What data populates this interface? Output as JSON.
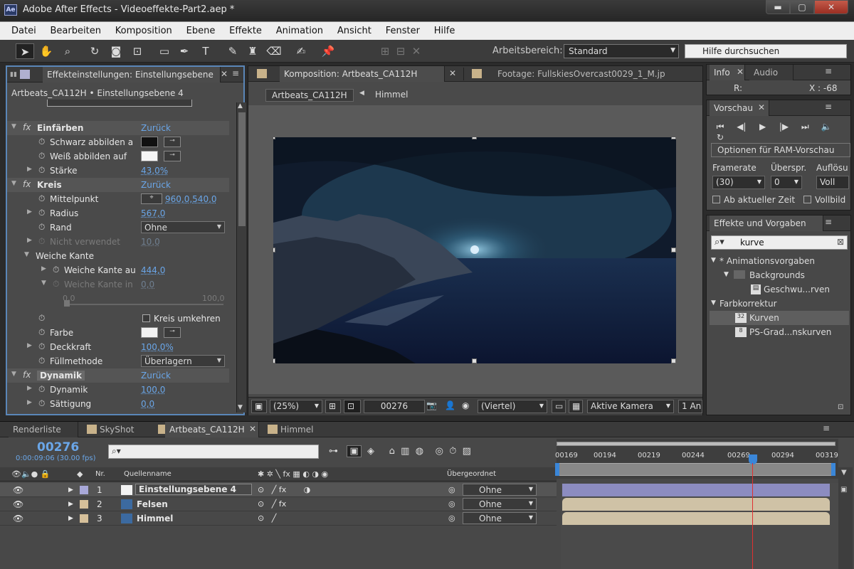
{
  "window": {
    "title": "Adobe After Effects - Videoeffekte-Part2.aep *",
    "logo": "Ae",
    "minimize": "▬",
    "maximize": "▢",
    "close": "✕"
  },
  "menu": [
    "Datei",
    "Bearbeiten",
    "Komposition",
    "Ebene",
    "Effekte",
    "Animation",
    "Ansicht",
    "Fenster",
    "Hilfe"
  ],
  "toolbar": {
    "workspace_label": "Arbeitsbereich:",
    "workspace_value": "Standard",
    "help_placeholder": "Hilfe durchsuchen"
  },
  "effect_panel": {
    "tab": "Effekteinstellungen: Einstellungsebene",
    "subtitle": "Artbeats_CA112H • Einstellungsebene 4",
    "rows": [
      {
        "type": "fx",
        "label": "Einfärben",
        "reset": "Zurück"
      },
      {
        "label": "Schwarz abbilden a",
        "swatch": "#111111"
      },
      {
        "label": "Weiß abbilden auf",
        "swatch": "#f5f5f5"
      },
      {
        "label": "Stärke",
        "value": "43,0%"
      },
      {
        "type": "fx",
        "label": "Kreis",
        "reset": "Zurück"
      },
      {
        "label": "Mittelpunkt",
        "value": "960,0,540,0"
      },
      {
        "label": "Radius",
        "value": "567,0"
      },
      {
        "label": "Rand",
        "dropdown": "Ohne"
      },
      {
        "label": "Nicht verwendet",
        "value": "10,0",
        "disabled": true
      },
      {
        "label": "Weiche Kante"
      },
      {
        "label": "Weiche Kante au",
        "value": "444,0"
      },
      {
        "label": "Weiche Kante in",
        "value": "0,0",
        "disabled": true
      },
      {
        "slider_min": "0,0",
        "slider_max": "100,0"
      },
      {
        "checkbox": "Kreis umkehren"
      },
      {
        "label": "Farbe",
        "swatch": "#f2f2f2"
      },
      {
        "label": "Deckkraft",
        "value": "100,0%"
      },
      {
        "label": "Füllmethode",
        "dropdown": "Überlagern"
      },
      {
        "type": "fx",
        "label": "Dynamik",
        "reset": "Zurück"
      },
      {
        "label": "Dynamik",
        "value": "100,0"
      },
      {
        "label": "Sättigung",
        "value": "0,0"
      }
    ]
  },
  "comp_panel": {
    "tab": "Komposition: Artbeats_CA112H",
    "footage_tab": "Footage: FullskiesOvercast0029_1_M.jp",
    "breadcrumb": [
      "Artbeats_CA112H",
      "Himmel"
    ],
    "zoom": "(25%)",
    "timecode": "00276",
    "resolution": "(Viertel)",
    "camera": "Aktive Kamera",
    "views": "1 An"
  },
  "info_panel": {
    "tabs": [
      "Info",
      "Audio"
    ],
    "r_label": "R:",
    "x_label": "X : -68"
  },
  "preview_panel": {
    "tab": "Vorschau",
    "buttons": [
      "⏮",
      "◀|",
      "▶",
      "|▶",
      "⏭",
      "🔈",
      "↻"
    ],
    "ram_button": "Optionen für RAM-Vorschau",
    "framerate_label": "Framerate",
    "framerate": "(30)",
    "skip_label": "Überspr.",
    "skip": "0",
    "resolution_label": "Auflösu",
    "resolution": "Voll",
    "from_current": "Ab aktueller Zeit",
    "fullscreen": "Vollbild"
  },
  "effects_presets": {
    "tab": "Effekte und Vorgaben",
    "search": "kurve",
    "tree": [
      {
        "label": "* Animationsvorgaben",
        "indent": 0,
        "arrow": "▼"
      },
      {
        "label": "Backgrounds",
        "indent": 1,
        "arrow": "▼",
        "icon": "folder"
      },
      {
        "label": "Geschwu...rven",
        "indent": 2,
        "icon": "preset"
      },
      {
        "label": "Farbkorrektur",
        "indent": 0,
        "arrow": "▼"
      },
      {
        "label": "Kurven",
        "indent": 1,
        "icon": "effect",
        "selected": true
      },
      {
        "label": "PS-Grad...nskurven",
        "indent": 1,
        "icon": "effect"
      }
    ]
  },
  "timeline": {
    "tabs": [
      "Renderliste",
      "SkyShot",
      "Artbeats_CA112H",
      "Himmel"
    ],
    "timecode": "00276",
    "timecode_sub": "0:00:09:06 (30.00 fps)",
    "col_nr": "Nr.",
    "col_source": "Quellenname",
    "col_parent": "Übergeordnet",
    "ruler": [
      "00169",
      "00194",
      "00219",
      "00244",
      "00269",
      "00294",
      "00319"
    ],
    "layers": [
      {
        "nr": "1",
        "name": "Einstellungsebene 4",
        "parent": "Ohne",
        "label_color": "#a8a8d8",
        "bar_color": "#8c8cc0"
      },
      {
        "nr": "2",
        "name": "Felsen",
        "parent": "Ohne",
        "label_color": "#d6c09a",
        "bar_color": "#cfc2a6"
      },
      {
        "nr": "3",
        "name": "Himmel",
        "parent": "Ohne",
        "label_color": "#d6c09a",
        "bar_color": "#cfc2a6"
      }
    ]
  }
}
